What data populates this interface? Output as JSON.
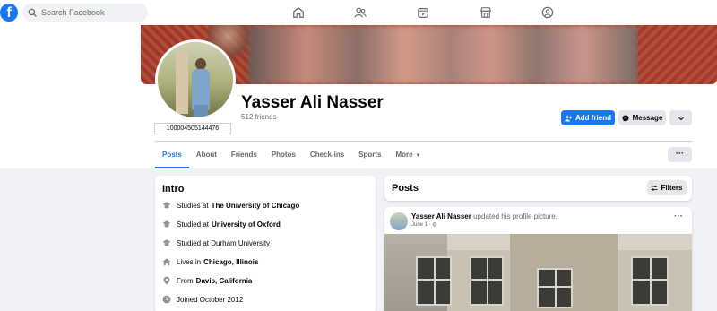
{
  "topbar": {
    "logo": "f",
    "search_placeholder": "Search Facebook",
    "nav_icons": [
      "home-icon",
      "friends-icon",
      "watch-icon",
      "marketplace-icon",
      "groups-icon"
    ]
  },
  "profile": {
    "name": "Yasser Ali Nasser",
    "friends": "512 friends",
    "user_id": "100004505144476",
    "add_friend_label": "Add friend",
    "message_label": "Message"
  },
  "tabs": [
    {
      "label": "Posts",
      "active": true
    },
    {
      "label": "About"
    },
    {
      "label": "Friends"
    },
    {
      "label": "Photos"
    },
    {
      "label": "Check-ins"
    },
    {
      "label": "Sports"
    },
    {
      "label": "More"
    }
  ],
  "intro": {
    "title": "Intro",
    "rows": [
      {
        "icon": "graduation-cap-icon",
        "prefix": "Studies at",
        "bold": "The University of Chicago"
      },
      {
        "icon": "graduation-cap-icon",
        "prefix": "Studied at",
        "bold": "University of Oxford"
      },
      {
        "icon": "graduation-cap-icon",
        "prefix": "Studied at Durham University",
        "bold": ""
      },
      {
        "icon": "house-icon",
        "prefix": "Lives in",
        "bold": "Chicago, Illinois"
      },
      {
        "icon": "location-pin-icon",
        "prefix": "From",
        "bold": "Davis, California"
      },
      {
        "icon": "clock-icon",
        "prefix": "Joined October 2012",
        "bold": ""
      }
    ]
  },
  "posts": {
    "title": "Posts",
    "filters_label": "Filters",
    "post": {
      "author": "Yasser Ali Nasser",
      "action": "updated his profile picture.",
      "date": "June 1",
      "privacy_icon": "globe-icon",
      "menu": "···"
    }
  },
  "more_menu": "···",
  "colors": {
    "brand": "#1877f2",
    "background": "#f0f2f5",
    "secondary_button": "#e4e6eb",
    "text_secondary": "#65676b"
  }
}
